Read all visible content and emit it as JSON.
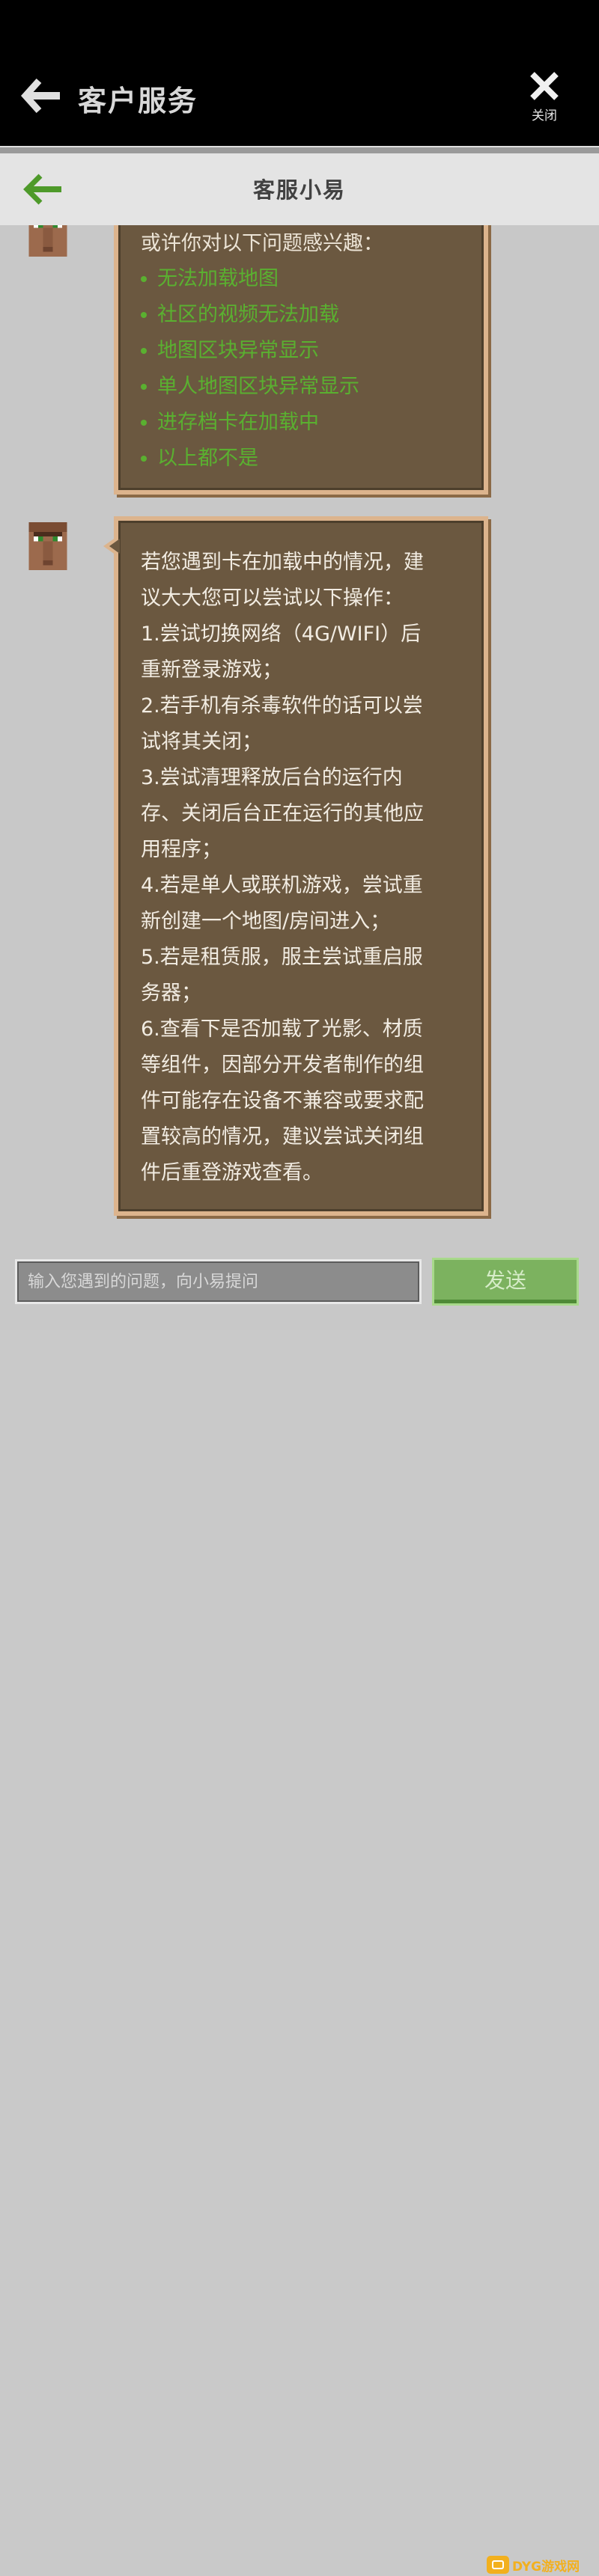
{
  "header": {
    "title": "客户服务",
    "close_label": "关闭"
  },
  "subheader": {
    "title": "客服小易"
  },
  "messages": {
    "suggestions": {
      "intro": "或许你对以下问题感兴趣：",
      "items": [
        "无法加载地图",
        "社区的视频无法加载",
        "地图区块异常显示",
        "单人地图区块异常显示",
        "进存档卡在加载中",
        "以上都不是"
      ]
    },
    "answer": {
      "lines": [
        "若您遇到卡在加载中的情况，建",
        "议大大您可以尝试以下操作：",
        "1.尝试切换网络（4G/WIFI）后",
        "重新登录游戏；",
        "2.若手机有杀毒软件的话可以尝",
        "试将其关闭；",
        "3.尝试清理释放后台的运行内",
        "存、关闭后台正在运行的其他应",
        "用程序；",
        "4.若是单人或联机游戏，尝试重",
        "新创建一个地图/房间进入；",
        "5.若是租赁服，服主尝试重启服",
        "务器；",
        "6.查看下是否加载了光影、材质",
        "等组件，因部分开发者制作的组",
        "件可能存在设备不兼容或要求配",
        "置较高的情况，建议尝试关闭组",
        "件后重登游戏查看。"
      ]
    }
  },
  "input": {
    "placeholder": "输入您遇到的问题，向小易提问",
    "send_label": "发送"
  },
  "watermark": {
    "text": "DYG游戏网"
  },
  "colors": {
    "bubble_bg": "#6b5840",
    "bubble_border": "#dcb48d",
    "option_green": "#5ab030",
    "send_green": "#7cb25f"
  }
}
